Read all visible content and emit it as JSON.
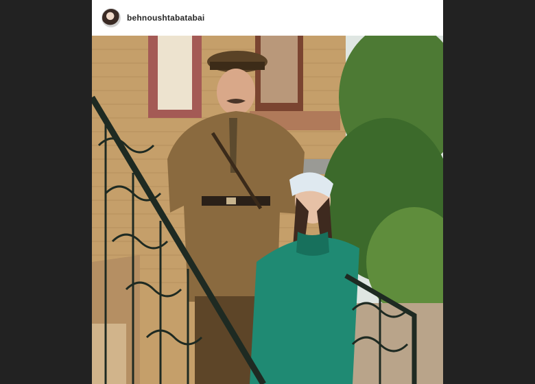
{
  "post": {
    "username": "behnoushtabatabai",
    "avatar_icon": "profile-avatar",
    "photo_description_icon": "post-photo"
  },
  "colors": {
    "backdrop": "#222222",
    "card": "#ffffff",
    "username": "#262626"
  }
}
